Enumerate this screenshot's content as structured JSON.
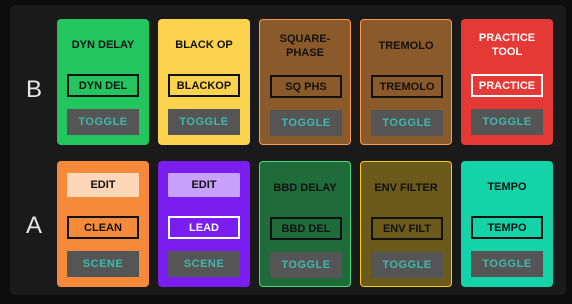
{
  "row_labels": {
    "top": "B",
    "bottom": "A"
  },
  "row_b": [
    {
      "title": "DYN DELAY",
      "name": "DYN DEL",
      "action": "TOGGLE",
      "color": "#22c55e"
    },
    {
      "title": "BLACK OP",
      "name": "BLACKOP",
      "action": "TOGGLE",
      "color": "#fcd34d"
    },
    {
      "title": "SQUARE-\nPHASE",
      "name": "SQ PHS",
      "action": "TOGGLE",
      "color": "#8b5a2b"
    },
    {
      "title": "TREMOLO",
      "name": "TREMOLO",
      "action": "TOGGLE",
      "color": "#8b5a2b"
    },
    {
      "title": "PRACTICE\nTOOL",
      "name": "PRACTICE",
      "action": "TOGGLE",
      "color": "#e53935"
    }
  ],
  "row_a": [
    {
      "edit": "EDIT",
      "name": "CLEAN",
      "action": "SCENE",
      "color": "#f58a3a"
    },
    {
      "edit": "EDIT",
      "name": "LEAD",
      "action": "SCENE",
      "color": "#7a1ef0"
    },
    {
      "title": "BBD DELAY",
      "name": "BBD DEL",
      "action": "TOGGLE",
      "color": "#1f6b3a"
    },
    {
      "title": "ENV FILTER",
      "name": "ENV FILT",
      "action": "TOGGLE",
      "color": "#6b5a1a"
    },
    {
      "title": "TEMPO",
      "name": "TEMPO",
      "action": "TOGGLE",
      "color": "#14d3a9"
    }
  ]
}
